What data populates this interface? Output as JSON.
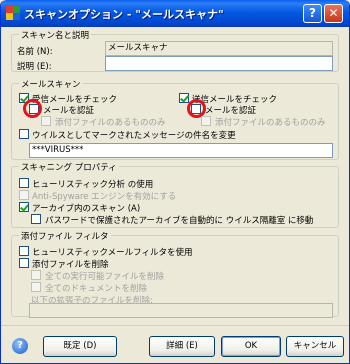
{
  "window": {
    "title": "スキャンオプション - \"メールスキャナ\"",
    "help_label": "?",
    "close_label": "✕"
  },
  "name_group": {
    "title": "スキャン名と説明",
    "name_label": "名前 (N):",
    "name_value": "メールスキャナ",
    "description_label": "説明 (E):",
    "description_value": ""
  },
  "mail_scan": {
    "title": "メールスキャン",
    "incoming": {
      "label": "受信メールをチェック",
      "checked": true,
      "authenticate_label": "メールを認証",
      "authenticate_checked": false,
      "attachments_only_label": "添付ファイルのあるもののみ"
    },
    "outgoing": {
      "label": "送信メールをチェック",
      "checked": true,
      "authenticate_label": "メールを認証",
      "authenticate_checked": false,
      "attachments_only_label": "添付ファイルのあるもののみ"
    },
    "subject_change_label": "ウイルスとしてマークされたメッセージの件名を変更",
    "subject_change_checked": false,
    "subject_tag_value": "***VIRUS***"
  },
  "scan_props": {
    "title": "スキャニング プロパティ",
    "heuristic_label": "ヒューリスティック分析 の使用",
    "heuristic_checked": false,
    "antispyware_label": "Anti-Spyware エンジンを有効にする",
    "archive_label": "アーカイブ内のスキャン (A)",
    "archive_checked": true,
    "password_archive_label": "パスワードで保護されたアーカイブを自動的に ウイルス隔離室 に移動",
    "password_archive_checked": false
  },
  "attach_filter": {
    "title": "添付ファイル フィルタ",
    "heuristic_filter_label": "ヒューリスティックメールフィルタを使用",
    "heuristic_filter_checked": false,
    "delete_attach_label": "添付ファイルを削除",
    "delete_attach_checked": false,
    "exe_label": "全ての実行可能ファイルを削除",
    "doc_label": "全てのドキュメントを削除",
    "ext_label": "以下の拡張子のファイルを削除:",
    "ext_value": ""
  },
  "buttons": {
    "default_label": "既定 (D)",
    "details_label": "詳細 (E)",
    "ok_label": "OK",
    "cancel_label": "キャンセル"
  },
  "colors": {
    "accent": "#0A5FF0",
    "highlight_circle": "#E8101A",
    "checkmark": "#21A121"
  }
}
